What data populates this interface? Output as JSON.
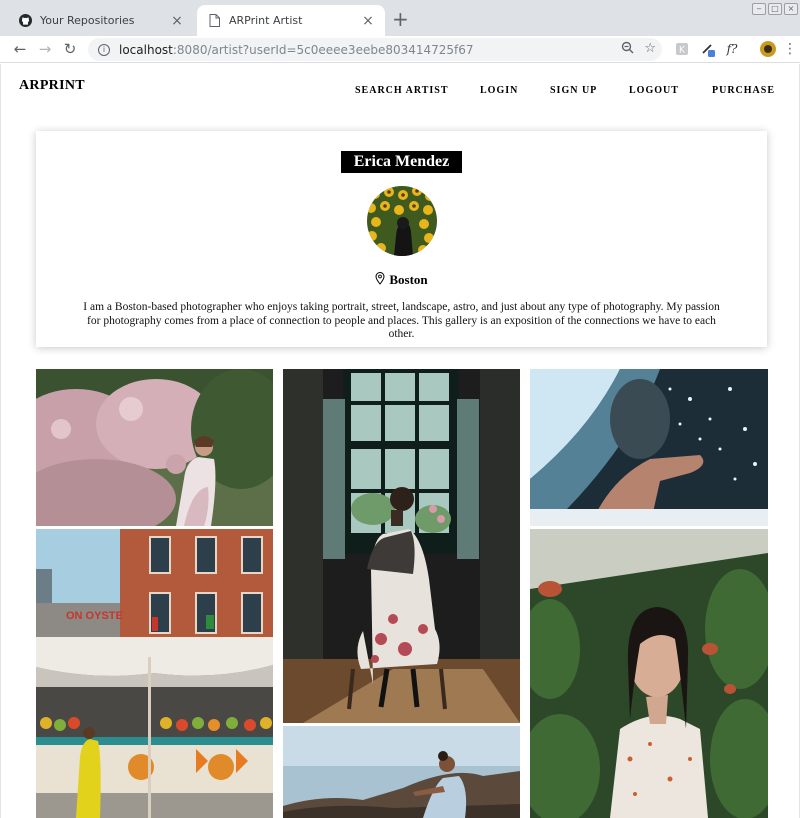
{
  "browser": {
    "tabs": [
      {
        "title": "Your Repositories",
        "icon": "github-icon",
        "active": false
      },
      {
        "title": "ARPrint Artist",
        "icon": "page-icon",
        "active": true
      }
    ],
    "new_tab_glyph": "+",
    "close_glyph": "×",
    "url_host": "localhost",
    "url_rest": ":8080/artist?userId=5c0eeee3eebe803414725f67",
    "info_glyph": "i",
    "extension_label": "f?"
  },
  "site": {
    "logo": "ARPRINT",
    "nav": [
      "SEARCH ARTIST",
      "LOGIN",
      "SIGN UP",
      "LOGOUT",
      "PURCHASE"
    ]
  },
  "artist": {
    "name": "Erica Mendez",
    "location": "Boston",
    "bio": "I am a Boston-based photographer who enjoys taking portrait, street, landscape, astro, and just about any type of photography. My passion for photography comes from a place of connection to people and places. This gallery is an exposition of the connections we have to each other."
  },
  "gallery": [
    {
      "subject": "woman-in-pink-flowers",
      "colors": [
        "#c9a3ad",
        "#3e5535",
        "#ead9dd"
      ]
    },
    {
      "subject": "brick-building-oyster-sign",
      "colors": [
        "#b55a3c",
        "#9fc6d9",
        "#4a6a7a"
      ]
    },
    {
      "subject": "fruit-market-yellow-dress",
      "colors": [
        "#e8e4dc",
        "#d8c41a",
        "#2d8a8c"
      ]
    },
    {
      "subject": "woman-silhouette-window",
      "colors": [
        "#1b1d1c",
        "#8fb3ad",
        "#6e4a30"
      ]
    },
    {
      "subject": "woman-on-rocks-sea",
      "colors": [
        "#9bb7c8",
        "#4a4038",
        "#d6e6f0"
      ]
    },
    {
      "subject": "hand-with-water-splash",
      "colors": [
        "#1e3340",
        "#9ed2e6",
        "#b88472"
      ]
    },
    {
      "subject": "woman-among-plants",
      "colors": [
        "#2f4a2b",
        "#e9e2d8",
        "#b46a4f"
      ]
    }
  ]
}
